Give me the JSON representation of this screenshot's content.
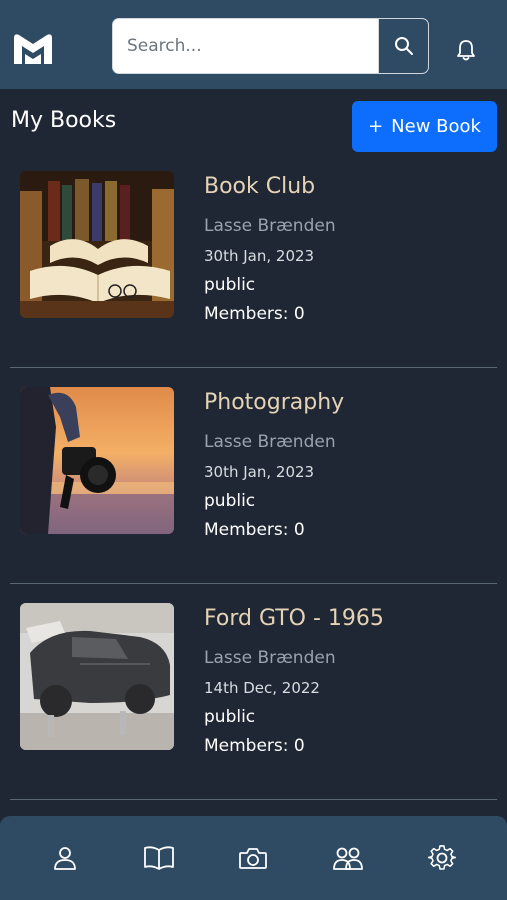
{
  "search": {
    "placeholder": "Search..."
  },
  "page": {
    "title": "My Books",
    "new_book_label": "New Book",
    "new_book_icon": "plus-icon"
  },
  "books": [
    {
      "title": "Book Club",
      "author": "Lasse Brænden",
      "date": "30th Jan, 2023",
      "visibility": "public",
      "members": "Members: 0",
      "image": "open-books-photo"
    },
    {
      "title": "Photography",
      "author": "Lasse Brænden",
      "date": "30th Jan, 2023",
      "visibility": "public",
      "members": "Members: 0",
      "image": "camera-sunset-photo"
    },
    {
      "title": "Ford GTO - 1965",
      "author": "Lasse Brænden",
      "date": "14th Dec, 2022",
      "visibility": "public",
      "members": "Members: 0",
      "image": "car-restoration-photo"
    }
  ],
  "icons": {
    "logo": "m-logo-icon",
    "search": "search-icon",
    "notifications": "bell-icon",
    "nav": [
      "person-icon",
      "book-icon",
      "camera-icon",
      "people-icon",
      "gear-icon"
    ]
  },
  "colors": {
    "header_bg": "#2f4a63",
    "page_bg": "#1e2733",
    "accent": "#0d6efd",
    "title_text": "#e6d3b6",
    "muted_text": "#9aa3ad"
  }
}
